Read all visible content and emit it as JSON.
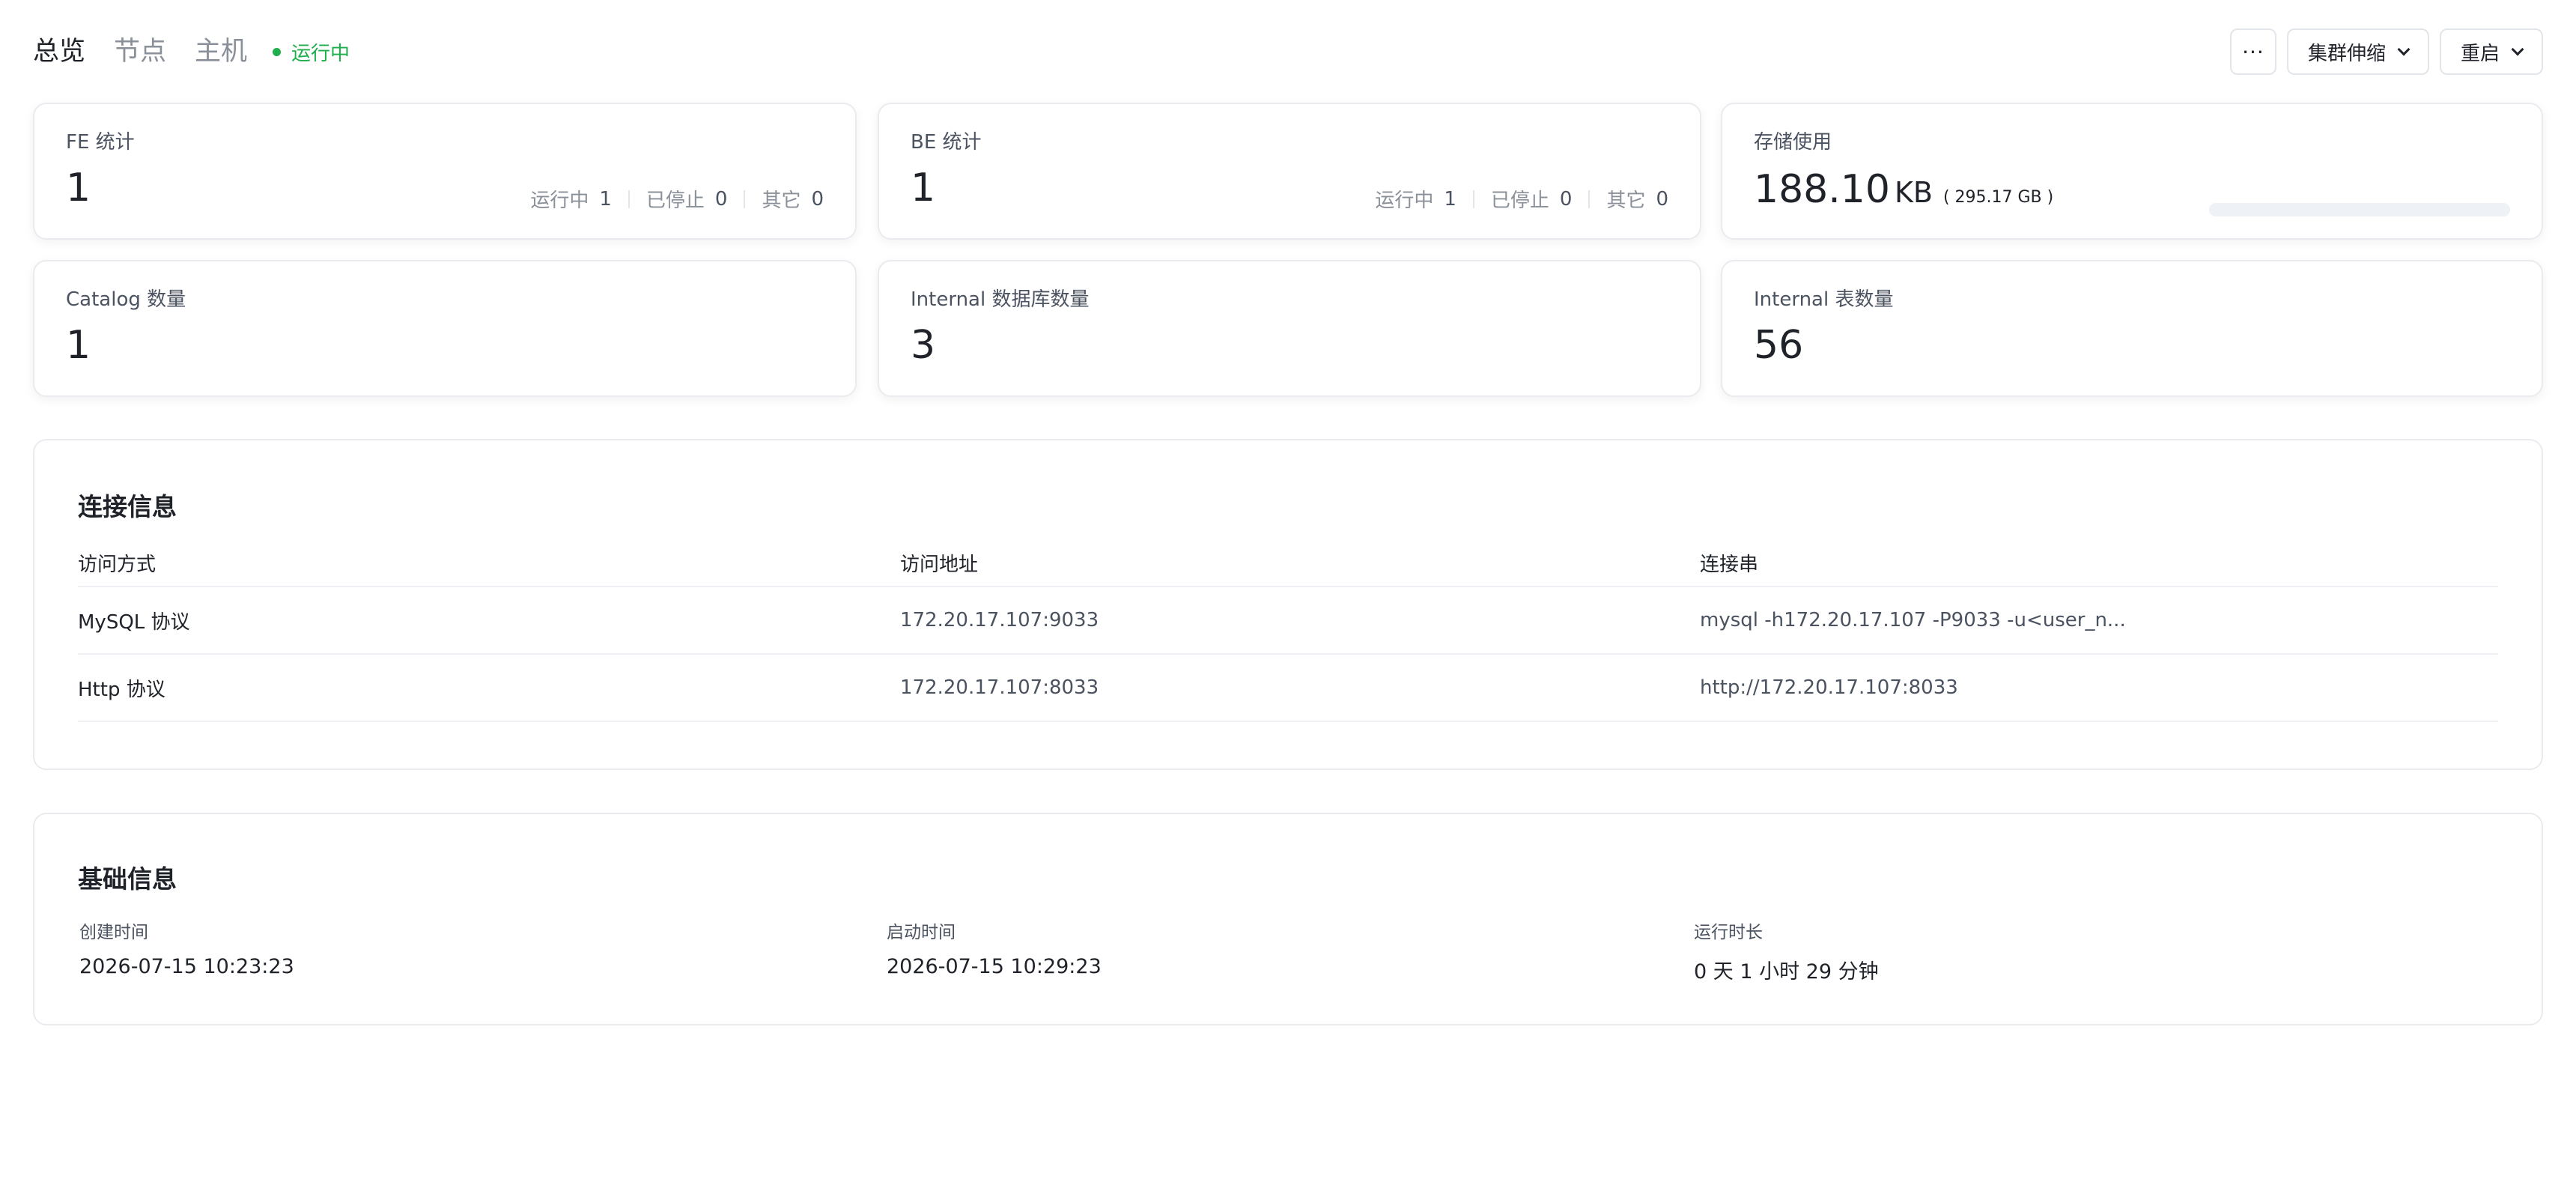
{
  "header": {
    "tabs": [
      "总览",
      "节点",
      "主机"
    ],
    "status": "运行中",
    "actions": {
      "more": "···",
      "scale": "集群伸缩",
      "restart": "重启"
    }
  },
  "stats": {
    "fe": {
      "label": "FE 统计",
      "value": "1",
      "running_label": "运行中",
      "running": "1",
      "stopped_label": "已停止",
      "stopped": "0",
      "other_label": "其它",
      "other": "0"
    },
    "be": {
      "label": "BE 统计",
      "value": "1",
      "running_label": "运行中",
      "running": "1",
      "stopped_label": "已停止",
      "stopped": "0",
      "other_label": "其它",
      "other": "0"
    },
    "storage": {
      "label": "存储使用",
      "value": "188.10",
      "unit": "KB",
      "total": "( 295.17 GB )",
      "used_fraction": 0.0
    },
    "catalog": {
      "label": "Catalog 数量",
      "value": "1"
    },
    "internal_db": {
      "label": "Internal 数据库数量",
      "value": "3"
    },
    "internal_table": {
      "label": "Internal 表数量",
      "value": "56"
    }
  },
  "connection": {
    "title": "连接信息",
    "columns": [
      "访问方式",
      "访问地址",
      "连接串"
    ],
    "rows": [
      [
        "MySQL 协议",
        "172.20.17.107:9033",
        "mysql -h172.20.17.107 -P9033 -u<user_n..."
      ],
      [
        "Http 协议",
        "172.20.17.107:8033",
        "http://172.20.17.107:8033"
      ]
    ]
  },
  "basic": {
    "title": "基础信息",
    "items": [
      {
        "label": "创建时间",
        "value": "2026-07-15 10:23:23"
      },
      {
        "label": "启动时间",
        "value": "2026-07-15 10:29:23"
      },
      {
        "label": "运行时长",
        "value": "0 天 1 小时 29 分钟"
      }
    ]
  },
  "colors": {
    "status_green": "#1fae4b",
    "text_primary": "#1f2329",
    "text_secondary": "#8a9099",
    "border": "#e9ebef"
  }
}
